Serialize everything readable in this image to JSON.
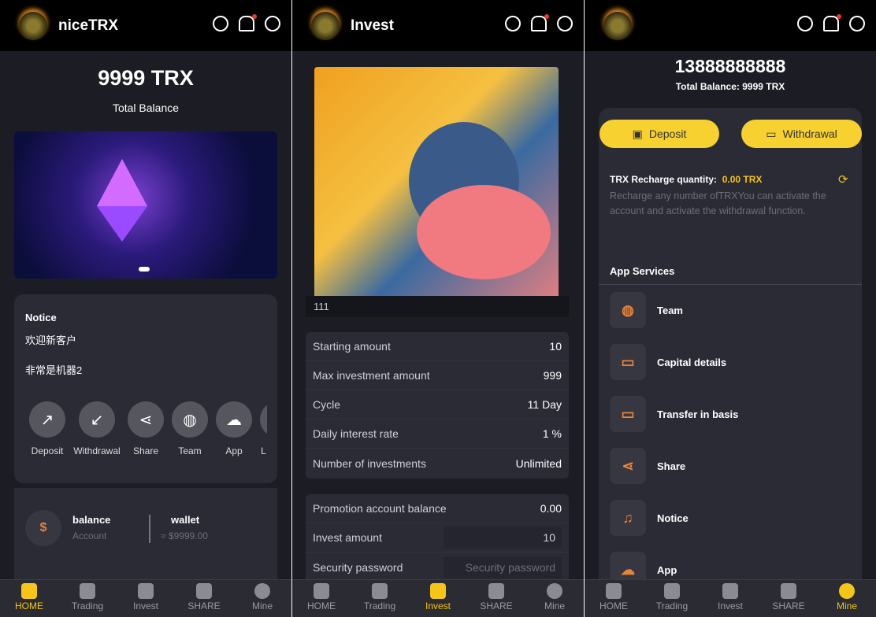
{
  "app": {
    "name": "niceTRX",
    "invest_title": "Invest",
    "accent": "#f5c518"
  },
  "home": {
    "balance": "9999 TRX",
    "balance_label": "Total Balance",
    "notice_title": "Notice",
    "notice_lines": [
      "欢迎新客户",
      "非常是机器2"
    ],
    "actions": [
      {
        "label": "Deposit",
        "icon": "arrow-up-right"
      },
      {
        "label": "Withdrawal",
        "icon": "arrow-down-left"
      },
      {
        "label": "Share",
        "icon": "share"
      },
      {
        "label": "Team",
        "icon": "globe"
      },
      {
        "label": "App",
        "icon": "cloud-download"
      },
      {
        "label": "L",
        "icon": "more"
      }
    ],
    "balance_item": {
      "title": "balance",
      "sub": "Account"
    },
    "wallet_item": {
      "title": "wallet",
      "sub": "≈ $9999.00"
    }
  },
  "invest": {
    "product_name": "111",
    "details": [
      {
        "label": "Starting amount",
        "value": "10"
      },
      {
        "label": "Max investment amount",
        "value": "999"
      },
      {
        "label": "Cycle",
        "value": "11 Day"
      },
      {
        "label": "Daily interest rate",
        "value": "1 %"
      },
      {
        "label": "Number of investments",
        "value": "Unlimited"
      }
    ],
    "form": {
      "promo_label": "Promotion account balance",
      "promo_value": "0.00",
      "amount_label": "Invest amount",
      "amount_value": "10",
      "password_label": "Security password",
      "password_placeholder": "Security password"
    }
  },
  "mine": {
    "phone": "13888888888",
    "total_label": "Total Balance:",
    "total_value": "9999 TRX",
    "deposit": "Deposit",
    "withdrawal": "Withdrawal",
    "recharge_label": "TRX Recharge quantity:",
    "recharge_value": "0.00 TRX",
    "recharge_note": "Recharge any number ofTRXYou can activate the account and activate the withdrawal function.",
    "services_title": "App Services",
    "services": [
      {
        "label": "Team",
        "icon": "globe"
      },
      {
        "label": "Capital details",
        "icon": "wallet"
      },
      {
        "label": "Transfer in basis",
        "icon": "wallet"
      },
      {
        "label": "Share",
        "icon": "share"
      },
      {
        "label": "Notice",
        "icon": "bell"
      },
      {
        "label": "App",
        "icon": "cloud-download"
      }
    ]
  },
  "nav": [
    {
      "label": "HOME",
      "icon": "home"
    },
    {
      "label": "Trading",
      "icon": "chart"
    },
    {
      "label": "Invest",
      "icon": "invest"
    },
    {
      "label": "SHARE",
      "icon": "heart"
    },
    {
      "label": "Mine",
      "icon": "user"
    }
  ]
}
